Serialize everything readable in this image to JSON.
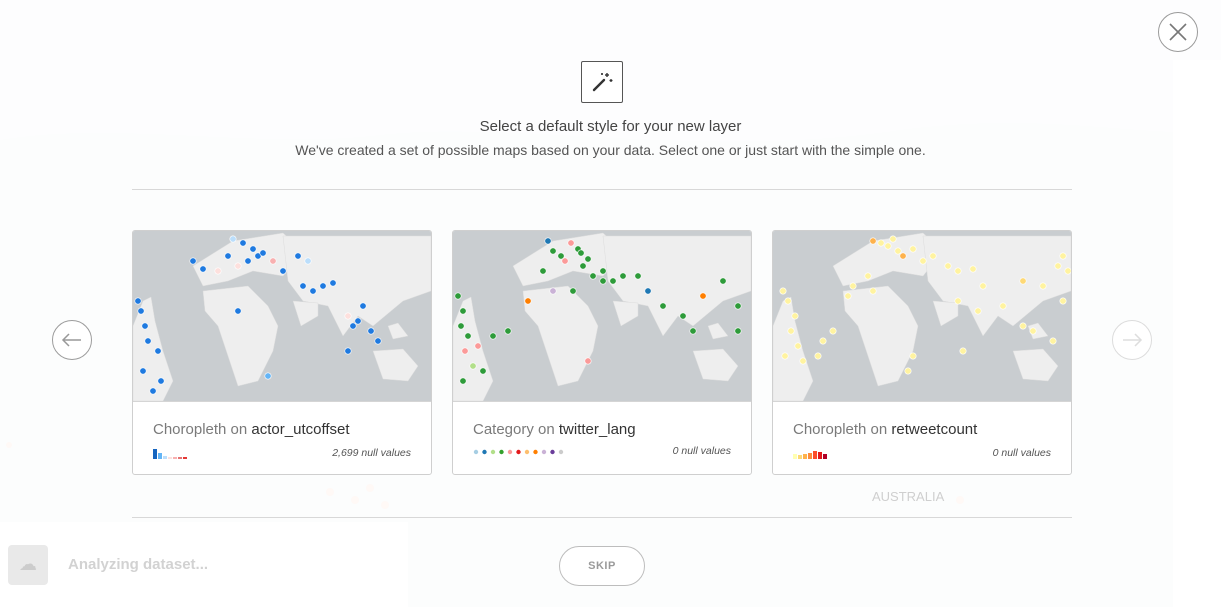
{
  "background": {
    "analyzing_text": "Analyzing dataset...",
    "australia_label": "AUSTRALIA"
  },
  "header": {
    "icon": "magic-wand-icon",
    "title": "Select a default style for your new layer",
    "subtitle": "We've created a set of possible maps based on your data. Select one or just start with the simple one."
  },
  "cards": [
    {
      "kind": "Choropleth on",
      "column": "actor_utcoffset",
      "nulls": "2,699 null values",
      "point_color": "#1f7ae0",
      "legend_colors": [
        "#1565c0",
        "#64b5f6",
        "#bbdefb",
        "#fde0dd",
        "#f8b0b0",
        "#e57373",
        "#e53935"
      ]
    },
    {
      "kind": "Category on",
      "column": "twitter_lang",
      "nulls": "0 null values",
      "point_color": "#2e9b3a",
      "legend_colors": [
        "#a6cee3",
        "#1f78b4",
        "#b2df8a",
        "#33a02c",
        "#fb9a99",
        "#e31a1c",
        "#fdbf6f",
        "#ff7f00",
        "#cab2d6",
        "#6a3d9a",
        "#cccccc"
      ]
    },
    {
      "kind": "Choropleth on",
      "column": "retweetcount",
      "nulls": "0 null values",
      "point_color": "#fff3a0",
      "legend_colors": [
        "#ffffb2",
        "#fed976",
        "#feb24c",
        "#fd8d3c",
        "#fc4e2a",
        "#e31a1c",
        "#b10026"
      ]
    }
  ],
  "skip_label": "SKIP"
}
